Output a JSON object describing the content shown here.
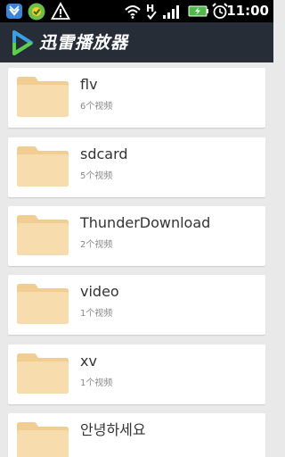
{
  "status_bar": {
    "time": "11:00",
    "icons": [
      "notification-shield-icon",
      "app-badge-icon",
      "warning-icon",
      "wifi-icon",
      "signal-hplus-icon",
      "battery-charging-icon",
      "alarm-clock-icon"
    ],
    "network_label": "H"
  },
  "app": {
    "title": "迅雷播放器",
    "colors": {
      "header_bg": "#262d36",
      "logo_blue": "#3aa0e6",
      "logo_green": "#5ccf4a",
      "folder_tan": "#f7dcae",
      "folder_tab": "#f1cd92"
    }
  },
  "folders": [
    {
      "name": "flv",
      "count": "6个视频"
    },
    {
      "name": "sdcard",
      "count": "5个视频"
    },
    {
      "name": "ThunderDownload",
      "count": "2个视频"
    },
    {
      "name": "video",
      "count": "1个视频"
    },
    {
      "name": "xv",
      "count": "1个视频"
    },
    {
      "name": "안녕하세요",
      "count": ""
    }
  ]
}
